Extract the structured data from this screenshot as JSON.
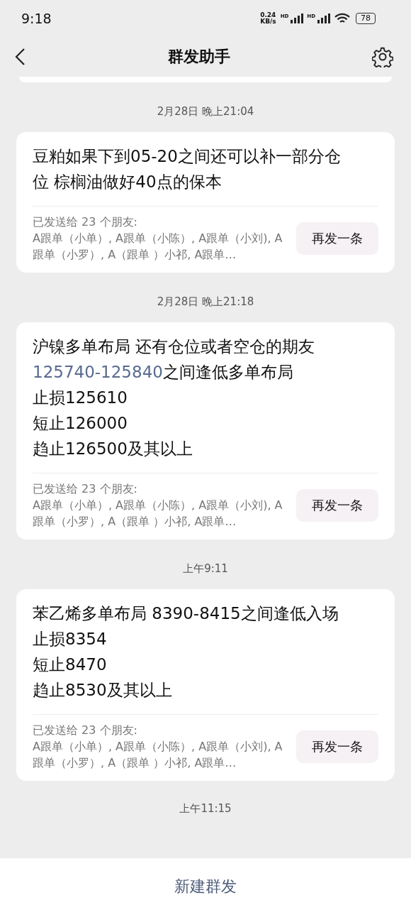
{
  "status_bar": {
    "time": "9:18",
    "speed": "0.24",
    "speed_unit": "KB/s",
    "hd_1": "HD",
    "hd_2": "HD",
    "battery": "78"
  },
  "header": {
    "title": "群发助手"
  },
  "messages": [
    {
      "timestamp": "2月28日 晚上21:04",
      "lines": [
        [
          {
            "text": "豆粕如果下到05-20之间还可以补一部分仓位 棕榈油做好40点的保本"
          }
        ]
      ],
      "sent_to": "已发送给 23 个朋友:",
      "recipients": "A跟单（小单）, A跟单（小陈）, A跟单（小刘), A跟单（小罗）, A（跟单 ）小祁, A跟单…",
      "button": "再发一条"
    },
    {
      "timestamp": "2月28日 晚上21:18",
      "lines": [
        [
          {
            "text": "沪镍多单布局 还有仓位或者空仓的期友"
          }
        ],
        [
          {
            "text": "125740-125840",
            "link": true
          },
          {
            "text": "之间逢低多单布局"
          }
        ],
        [
          {
            "text": "止损125610"
          }
        ],
        [
          {
            "text": "短止126000"
          }
        ],
        [
          {
            "text": "趋止126500及其以上"
          }
        ]
      ],
      "sent_to": "已发送给 23 个朋友:",
      "recipients": "A跟单（小单）, A跟单（小陈）, A跟单（小刘), A跟单（小罗）, A（跟单 ）小祁, A跟单…",
      "button": "再发一条"
    },
    {
      "timestamp": "上午9:11",
      "lines": [
        [
          {
            "text": "苯乙烯多单布局 8390-8415之间逢低入场"
          }
        ],
        [
          {
            "text": "止损8354"
          }
        ],
        [
          {
            "text": "短止8470"
          }
        ],
        [
          {
            "text": "趋止8530及其以上"
          }
        ]
      ],
      "sent_to": "已发送给 23 个朋友:",
      "recipients": "A跟单（小单）, A跟单（小陈）, A跟单（小刘), A跟单（小罗）, A（跟单 ）小祁, A跟单…",
      "button": "再发一条"
    }
  ],
  "last_timestamp": "上午11:15",
  "bottom_button": "新建群发"
}
